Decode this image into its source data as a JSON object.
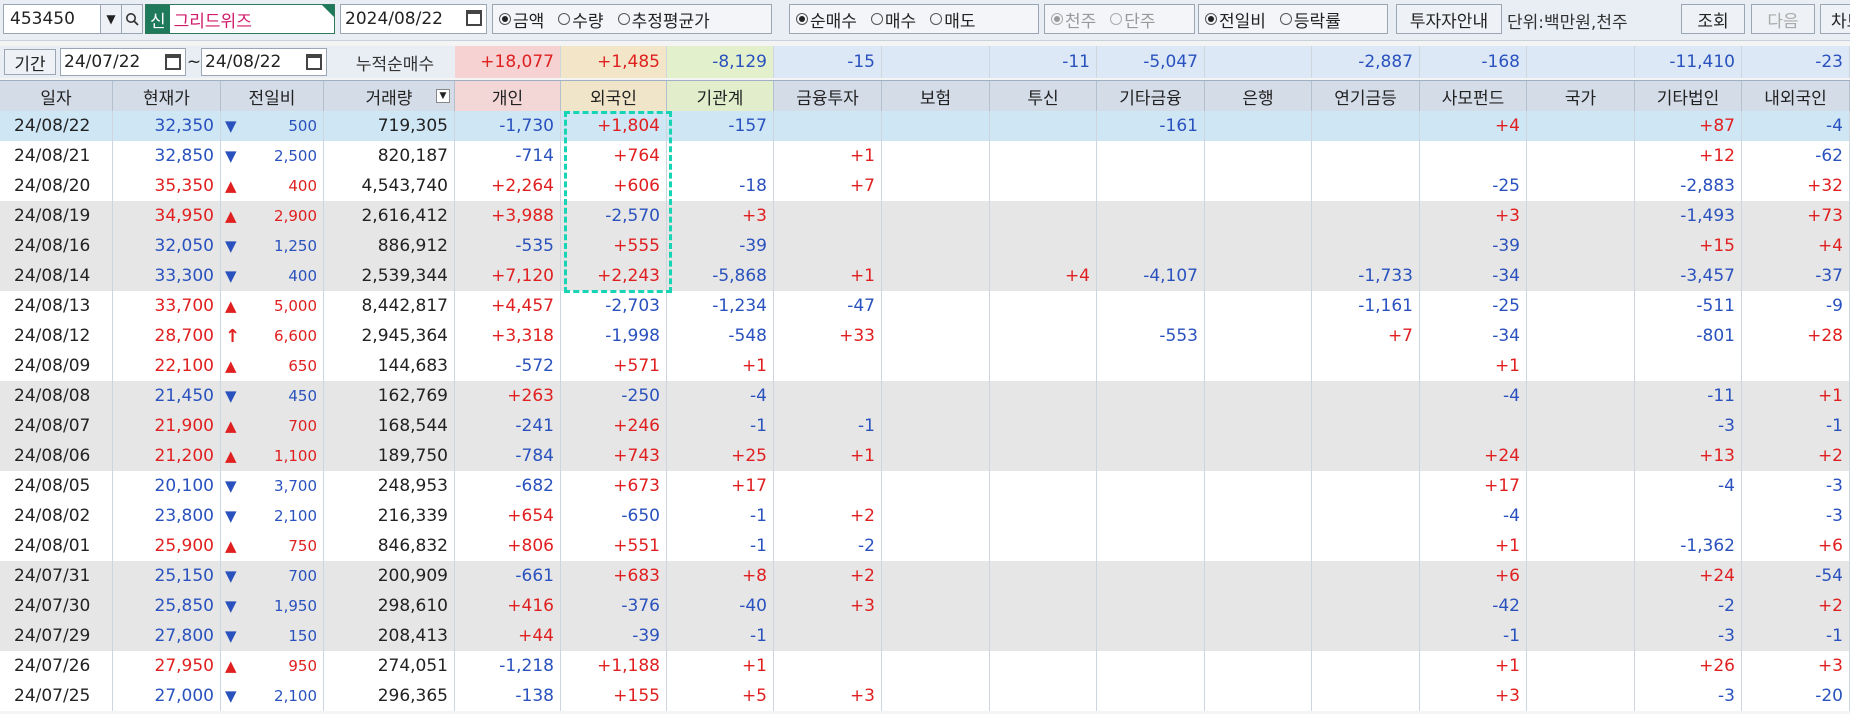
{
  "toolbar": {
    "code": "453450",
    "shin_badge": "신",
    "name": "그리드위즈",
    "date": "2024/08/22",
    "radio_group1": [
      {
        "label": "금액",
        "checked": true
      },
      {
        "label": "수량",
        "checked": false
      },
      {
        "label": "추정평균가",
        "checked": false
      }
    ],
    "radio_group2": [
      {
        "label": "순매수",
        "checked": true
      },
      {
        "label": "매수",
        "checked": false
      },
      {
        "label": "매도",
        "checked": false
      }
    ],
    "radio_group3": [
      {
        "label": "천주",
        "checked": true
      },
      {
        "label": "단주",
        "checked": false
      }
    ],
    "radio_group4": [
      {
        "label": "전일비",
        "checked": true
      },
      {
        "label": "등락률",
        "checked": false
      }
    ],
    "guide_btn": "투자자안내",
    "unit": "단위:백만원,천주",
    "query_btn": "조회",
    "next_btn": "다음",
    "chart_btn": "차트"
  },
  "period": {
    "label": "기간",
    "from": "24/07/22",
    "tilde": "~",
    "to": "24/08/22",
    "cum_label": "누적순매수"
  },
  "summary": [
    "+18,077",
    "+1,485",
    "-8,129",
    "-15",
    "",
    "-11",
    "-5,047",
    "",
    "-2,887",
    "-168",
    "",
    "-11,410",
    "-23"
  ],
  "headers": [
    "일자",
    "현재가",
    "전일비",
    "거래량",
    "개인",
    "외국인",
    "기관계",
    "금융투자",
    "보험",
    "투신",
    "기타금융",
    "은행",
    "연기금등",
    "사모펀드",
    "국가",
    "기타법인",
    "내외국인"
  ],
  "rows": [
    {
      "date": "24/08/22",
      "price": "32,350",
      "dir": "down",
      "change": "500",
      "volume": "719,305",
      "v": [
        "-1,730",
        "+1,804",
        "-157",
        "",
        "",
        "",
        "-161",
        "",
        "",
        "+4",
        "",
        "+87",
        "-4"
      ]
    },
    {
      "date": "24/08/21",
      "price": "32,850",
      "dir": "down",
      "change": "2,500",
      "volume": "820,187",
      "v": [
        "-714",
        "+764",
        "",
        "+1",
        "",
        "",
        "",
        "",
        "",
        "",
        "",
        "+12",
        "-62"
      ]
    },
    {
      "date": "24/08/20",
      "price": "35,350",
      "dir": "up",
      "change": "400",
      "volume": "4,543,740",
      "v": [
        "+2,264",
        "+606",
        "-18",
        "+7",
        "",
        "",
        "",
        "",
        "",
        "-25",
        "",
        "-2,883",
        "+32"
      ]
    },
    {
      "date": "24/08/19",
      "price": "34,950",
      "dir": "up",
      "change": "2,900",
      "volume": "2,616,412",
      "v": [
        "+3,988",
        "-2,570",
        "+3",
        "",
        "",
        "",
        "",
        "",
        "",
        "+3",
        "",
        "-1,493",
        "+73"
      ]
    },
    {
      "date": "24/08/16",
      "price": "32,050",
      "dir": "down",
      "change": "1,250",
      "volume": "886,912",
      "v": [
        "-535",
        "+555",
        "-39",
        "",
        "",
        "",
        "",
        "",
        "",
        "-39",
        "",
        "+15",
        "+4"
      ]
    },
    {
      "date": "24/08/14",
      "price": "33,300",
      "dir": "down",
      "change": "400",
      "volume": "2,539,344",
      "v": [
        "+7,120",
        "+2,243",
        "-5,868",
        "+1",
        "",
        "+4",
        "-4,107",
        "",
        "-1,733",
        "-34",
        "",
        "-3,457",
        "-37"
      ]
    },
    {
      "date": "24/08/13",
      "price": "33,700",
      "dir": "up",
      "change": "5,000",
      "volume": "8,442,817",
      "v": [
        "+4,457",
        "-2,703",
        "-1,234",
        "-47",
        "",
        "",
        "",
        "",
        "-1,161",
        "-25",
        "",
        "-511",
        "-9"
      ]
    },
    {
      "date": "24/08/12",
      "price": "28,700",
      "dir": "limitup",
      "change": "6,600",
      "volume": "2,945,364",
      "v": [
        "+3,318",
        "-1,998",
        "-548",
        "+33",
        "",
        "",
        "-553",
        "",
        "+7",
        "-34",
        "",
        "-801",
        "+28"
      ]
    },
    {
      "date": "24/08/09",
      "price": "22,100",
      "dir": "up",
      "change": "650",
      "volume": "144,683",
      "v": [
        "-572",
        "+571",
        "+1",
        "",
        "",
        "",
        "",
        "",
        "",
        "+1",
        "",
        "",
        ""
      ]
    },
    {
      "date": "24/08/08",
      "price": "21,450",
      "dir": "down",
      "change": "450",
      "volume": "162,769",
      "v": [
        "+263",
        "-250",
        "-4",
        "",
        "",
        "",
        "",
        "",
        "",
        "-4",
        "",
        "-11",
        "+1"
      ]
    },
    {
      "date": "24/08/07",
      "price": "21,900",
      "dir": "up",
      "change": "700",
      "volume": "168,544",
      "v": [
        "-241",
        "+246",
        "-1",
        "-1",
        "",
        "",
        "",
        "",
        "",
        "",
        "",
        "-3",
        "-1"
      ]
    },
    {
      "date": "24/08/06",
      "price": "21,200",
      "dir": "up",
      "change": "1,100",
      "volume": "189,750",
      "v": [
        "-784",
        "+743",
        "+25",
        "+1",
        "",
        "",
        "",
        "",
        "",
        "+24",
        "",
        "+13",
        "+2"
      ]
    },
    {
      "date": "24/08/05",
      "price": "20,100",
      "dir": "down",
      "change": "3,700",
      "volume": "248,953",
      "v": [
        "-682",
        "+673",
        "+17",
        "",
        "",
        "",
        "",
        "",
        "",
        "+17",
        "",
        "-4",
        "-3"
      ]
    },
    {
      "date": "24/08/02",
      "price": "23,800",
      "dir": "down",
      "change": "2,100",
      "volume": "216,339",
      "v": [
        "+654",
        "-650",
        "-1",
        "+2",
        "",
        "",
        "",
        "",
        "",
        "-4",
        "",
        "",
        "-3"
      ]
    },
    {
      "date": "24/08/01",
      "price": "25,900",
      "dir": "up",
      "change": "750",
      "volume": "846,832",
      "v": [
        "+806",
        "+551",
        "-1",
        "-2",
        "",
        "",
        "",
        "",
        "",
        "+1",
        "",
        "-1,362",
        "+6"
      ]
    },
    {
      "date": "24/07/31",
      "price": "25,150",
      "dir": "down",
      "change": "700",
      "volume": "200,909",
      "v": [
        "-661",
        "+683",
        "+8",
        "+2",
        "",
        "",
        "",
        "",
        "",
        "+6",
        "",
        "+24",
        "-54"
      ]
    },
    {
      "date": "24/07/30",
      "price": "25,850",
      "dir": "down",
      "change": "1,950",
      "volume": "298,610",
      "v": [
        "+416",
        "-376",
        "-40",
        "+3",
        "",
        "",
        "",
        "",
        "",
        "-42",
        "",
        "-2",
        "+2"
      ]
    },
    {
      "date": "24/07/29",
      "price": "27,800",
      "dir": "down",
      "change": "150",
      "volume": "208,413",
      "v": [
        "+44",
        "-39",
        "-1",
        "",
        "",
        "",
        "",
        "",
        "",
        "-1",
        "",
        "-3",
        "-1"
      ]
    },
    {
      "date": "24/07/26",
      "price": "27,950",
      "dir": "up",
      "change": "950",
      "volume": "274,051",
      "v": [
        "-1,218",
        "+1,188",
        "+1",
        "",
        "",
        "",
        "",
        "",
        "",
        "+1",
        "",
        "+26",
        "+3"
      ]
    },
    {
      "date": "24/07/25",
      "price": "27,000",
      "dir": "down",
      "change": "2,100",
      "volume": "296,365",
      "v": [
        "-138",
        "+155",
        "+5",
        "+3",
        "",
        "",
        "",
        "",
        "",
        "+3",
        "",
        "-3",
        "-20"
      ]
    }
  ],
  "colors": {
    "up": "#e02020",
    "down": "#2a52be",
    "row_selected": "#cfe6f5",
    "row_shaded": "#e6e6e6",
    "row_plain": "#ffffff",
    "highlight_box": "#17d4b4",
    "sum_individual": "#f6d2d2",
    "sum_foreign": "#f3e6c8",
    "sum_institution": "#e3f0cc"
  },
  "arrow_glyphs": {
    "up": "▲",
    "down": "▼",
    "limitup": "↑"
  }
}
